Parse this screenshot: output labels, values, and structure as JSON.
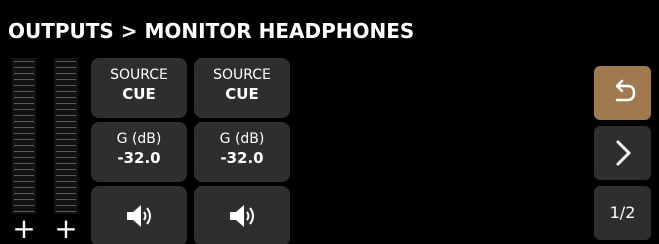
{
  "header": {
    "title": "OUTPUTS > MONITOR HEADPHONES"
  },
  "meters": [
    {
      "add_label": "+"
    },
    {
      "add_label": "+"
    }
  ],
  "channels": [
    {
      "source_label": "SOURCE",
      "source_value": "CUE",
      "gain_label": "G (dB)",
      "gain_value": "-32.0",
      "speaker_icon": "speaker-icon"
    },
    {
      "source_label": "SOURCE",
      "source_value": "CUE",
      "gain_label": "G (dB)",
      "gain_value": "-32.0",
      "speaker_icon": "speaker-icon"
    }
  ],
  "nav": {
    "back_icon": "undo-arrow-icon",
    "next_icon": "chevron-right-icon",
    "page_indicator": "1/2"
  },
  "colors": {
    "background": "#000000",
    "button": "#2e2e2e",
    "back_button": "#a07a4f",
    "meter_segment": "#5a5a5a",
    "text": "#ffffff"
  }
}
